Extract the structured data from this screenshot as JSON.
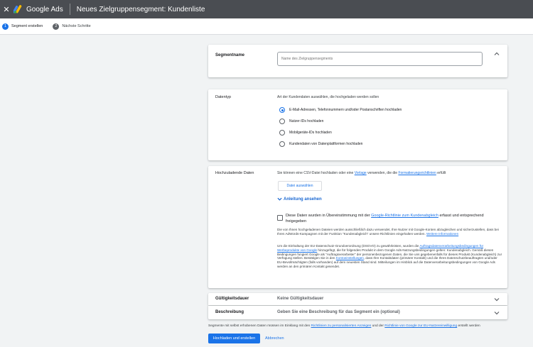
{
  "header": {
    "close_symbol": "✕",
    "brand": "Google Ads",
    "title": "Neues Zielgruppensegment: Kundenliste"
  },
  "steps": [
    {
      "number": "1",
      "label": "Segment erstellen"
    },
    {
      "number": "2",
      "label": "Nächste Schritte"
    }
  ],
  "segment_name": {
    "label": "Segmentname",
    "placeholder": "Name des Zielgruppensegments"
  },
  "data_type": {
    "label": "Datentyp",
    "description": "Art der Kundendaten auswählen, die hochgeladen werden sollen",
    "options": [
      "E-Mail-Adressen, Telefonnummern und/oder Postanschriften hochladen",
      "Nutzer-IDs hochladen",
      "Mobilgeräte-IDs hochladen",
      "Kundendaten von Datenplattformen hochladen"
    ],
    "selected_index": 0
  },
  "upload": {
    "label": "Hochzuladende Daten",
    "intro_1": "Sie können eine CSV-Datei hochladen oder eine",
    "intro_link_1": "Vorlage",
    "intro_2": "verwenden, die die",
    "intro_link_2": "Formatierungsrichtlinien",
    "intro_3": "erfüllt",
    "select_file_button": "Datei auswählen",
    "guide_toggle": "Anleitung ansehen",
    "checkbox_text_1": "Diese Daten wurden in Übereinstimmung mit der",
    "checkbox_link": "Google-Richtlinie zum Kundenabgleich",
    "checkbox_text_2": "erfasst und entsprechend freigegeben",
    "info_text": "Die von Ihnen hochgeladenen Dateien werden ausschließlich dazu verwendet, Ihre Nutzer mit Google-Konten abzugleichen und sicherzustellen, dass bei Ihren AdWords-Kampagnen mit der Funktion \"Kundenabgleich\" unsere Richtlinien eingehalten werden.",
    "info_link": "Weitere Informationen",
    "gdpr_text_1": "Um die Einhaltung der EU-Datenschutz-Grundverordnung (DSGVO) zu gewährleisten, wurden die",
    "gdpr_link_1": "Auftragsdatenverarbeitungsbedingungen für Werbeprodukte von Google",
    "gdpr_text_2": "hinzugefügt, die für folgendes Produkt in dem Google Ads-Nutzungsbedingungen gelten: Kundenabgleich. Gemäß diesen Bedingungen fungiert Google als \"Auftragsverarbeiter\" der personenbezogenen Daten, die Sie uns gegebenenfalls für dieses Produkt (Kundenabgleich) zur Verfügung stellen. Bestätigen Sie in den",
    "gdpr_link_2": "Kontoeinstellungen",
    "gdpr_text_3": ", dass Ihre Kontaktdaten (primärer Kontakt) und die Ihres Datenschutzbeauftragten und/oder EU-Bevollmächtigten (falls vorhanden) auf dem neuesten Stand sind. Mitteilungen im Hinblick auf die Datenverarbeitungsbedingungen von Google Ads werden an den primären Kontakt gesendet."
  },
  "validity": {
    "label": "Gültigkeitsdauer",
    "value": "Keine Gültigkeitsdauer"
  },
  "description": {
    "label": "Beschreibung",
    "value": "Geben Sie eine Beschreibung für das Segment ein (optional)"
  },
  "footer": {
    "text_1": "Segmente mit selbst erhobenen Daten müssen im Einklang mit den",
    "link_1": "Richtlinien zu personalisierten Anzeigen",
    "text_2": "und der",
    "link_2": "Richtlinie von Google zur EU-Nutzereinwilligung",
    "text_3": "erstellt werden",
    "create_button": "Hochladen und erstellen",
    "cancel_button": "Abbrechen"
  },
  "colors": {
    "topbar": "#4a4d52",
    "accent": "#1a73e8",
    "background": "#f1f3f4"
  }
}
